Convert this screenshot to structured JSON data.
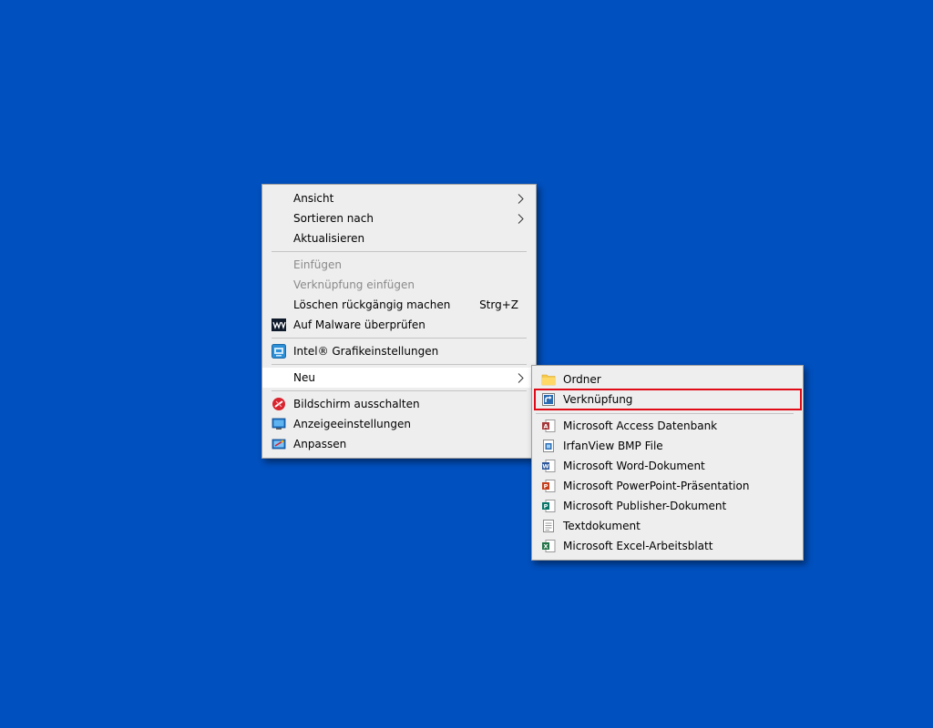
{
  "desktop": {
    "background_color": "#0050bf"
  },
  "context_menu": {
    "items": [
      {
        "label": "Ansicht",
        "submenu": true
      },
      {
        "label": "Sortieren nach",
        "submenu": true
      },
      {
        "label": "Aktualisieren"
      },
      {
        "label": "Einfügen",
        "disabled": true
      },
      {
        "label": "Verknüpfung einfügen",
        "disabled": true
      },
      {
        "label": "Löschen rückgängig machen",
        "shortcut": "Strg+Z"
      },
      {
        "label": "Auf Malware überprüfen",
        "icon": "malwarebytes-icon"
      },
      {
        "label": "Intel® Grafikeinstellungen",
        "icon": "intel-graphics-icon"
      },
      {
        "label": "Neu",
        "submenu": true,
        "hovered": true
      },
      {
        "label": "Bildschirm ausschalten",
        "icon": "screen-off-icon"
      },
      {
        "label": "Anzeigeeinstellungen",
        "icon": "display-settings-icon"
      },
      {
        "label": "Anpassen",
        "icon": "personalize-icon"
      }
    ]
  },
  "new_submenu": {
    "items": [
      {
        "label": "Ordner",
        "icon": "folder-icon"
      },
      {
        "label": "Verknüpfung",
        "icon": "shortcut-icon",
        "highlighted": true
      },
      {
        "label": "Microsoft Access Datenbank",
        "icon": "access-icon"
      },
      {
        "label": "IrfanView BMP File",
        "icon": "bmp-file-icon"
      },
      {
        "label": "Microsoft Word-Dokument",
        "icon": "word-icon"
      },
      {
        "label": "Microsoft PowerPoint-Präsentation",
        "icon": "powerpoint-icon"
      },
      {
        "label": "Microsoft Publisher-Dokument",
        "icon": "publisher-icon"
      },
      {
        "label": "Textdokument",
        "icon": "text-document-icon"
      },
      {
        "label": "Microsoft Excel-Arbeitsblatt",
        "icon": "excel-icon"
      }
    ],
    "highlight_color": "#e00b16"
  }
}
